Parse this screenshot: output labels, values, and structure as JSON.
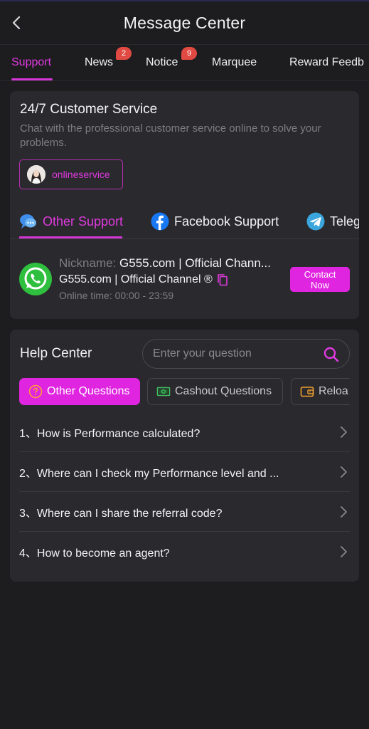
{
  "header": {
    "title": "Message Center"
  },
  "tabs": [
    {
      "label": "Support"
    },
    {
      "label": "News",
      "badge": "2"
    },
    {
      "label": "Notice",
      "badge": "9"
    },
    {
      "label": "Marquee"
    },
    {
      "label": "Reward Feedb"
    }
  ],
  "customer_service": {
    "title": "24/7 Customer Service",
    "description": "Chat with the professional customer service online to solve your problems.",
    "online_button": "onlineservice",
    "support_tabs": [
      {
        "label": "Other Support",
        "icon": "chat-bubbles-icon"
      },
      {
        "label": "Facebook Support",
        "icon": "facebook-icon"
      },
      {
        "label": "Teleg",
        "icon": "telegram-icon"
      }
    ],
    "contact": {
      "nickname_label": "Nickname:",
      "nickname": "G555.com | Official Chann...",
      "channel": "G555.com | Official Channel ®",
      "time_label": "Online time:",
      "time": "00:00 - 23:59",
      "button_line1": "Contact",
      "button_line2": "Now"
    }
  },
  "help_center": {
    "title": "Help Center",
    "search_placeholder": "Enter your question",
    "categories": [
      {
        "label": "Other Questions",
        "icon": "question-circle-icon"
      },
      {
        "label": "Cashout Questions",
        "icon": "cash-icon"
      },
      {
        "label": "Reloa",
        "icon": "wallet-icon"
      }
    ],
    "questions": [
      "1、How is Performance calculated?",
      "2、Where can I check my Performance level and ...",
      "3、Where can I share the referral code?",
      "4、How to become an agent?"
    ]
  },
  "colors": {
    "accent": "#e025e0",
    "background": "#1d1c1f",
    "card": "#2a292d",
    "badge": "#e04a42",
    "muted_text": "#7e7d84"
  }
}
